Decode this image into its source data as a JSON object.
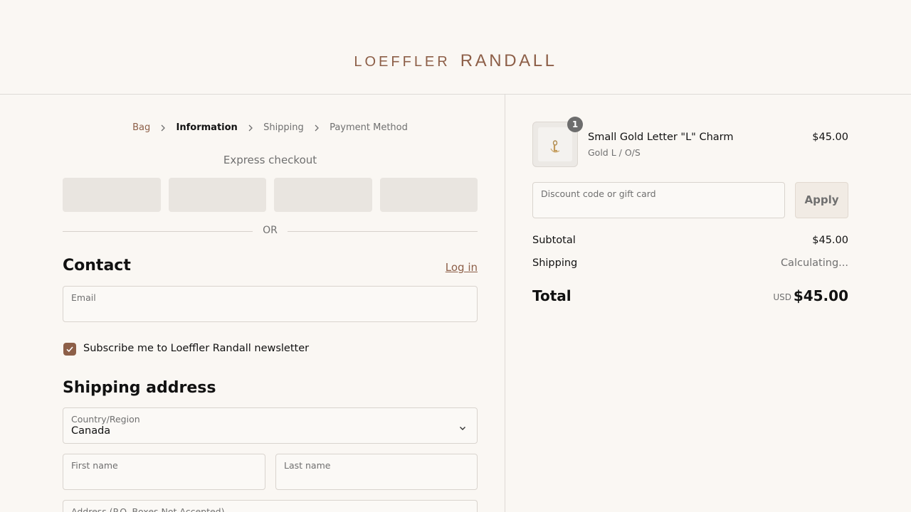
{
  "brand": {
    "word1": "LOEFFLER",
    "word2": "RANDALL",
    "color": "#8d5f48"
  },
  "breadcrumb": {
    "items": [
      "Bag",
      "Information",
      "Shipping",
      "Payment Method"
    ],
    "active": "Information"
  },
  "express": {
    "title": "Express checkout",
    "button_count": 4
  },
  "divider": {
    "or_label": "OR"
  },
  "contact": {
    "heading": "Contact",
    "login_label": "Log in",
    "email_label": "Email",
    "email_value": "",
    "newsletter_checked": true,
    "newsletter_label": "Subscribe me to Loeffler Randall newsletter"
  },
  "shipping": {
    "heading": "Shipping address",
    "country_label": "Country/Region",
    "country_value": "Canada",
    "first_name_label": "First name",
    "last_name_label": "Last name",
    "address_label": "Address (P.O. Boxes Not Accepted)"
  },
  "order": {
    "item": {
      "quantity": "1",
      "name": "Small Gold Letter \"L\" Charm",
      "variant": "Gold L / O/S",
      "price": "$45.00"
    },
    "discount_label": "Discount code or gift card",
    "apply_label": "Apply",
    "subtotal_label": "Subtotal",
    "subtotal_value": "$45.00",
    "shipping_label": "Shipping",
    "shipping_value": "Calculating...",
    "total_label": "Total",
    "total_currency": "USD",
    "total_value": "$45.00"
  }
}
